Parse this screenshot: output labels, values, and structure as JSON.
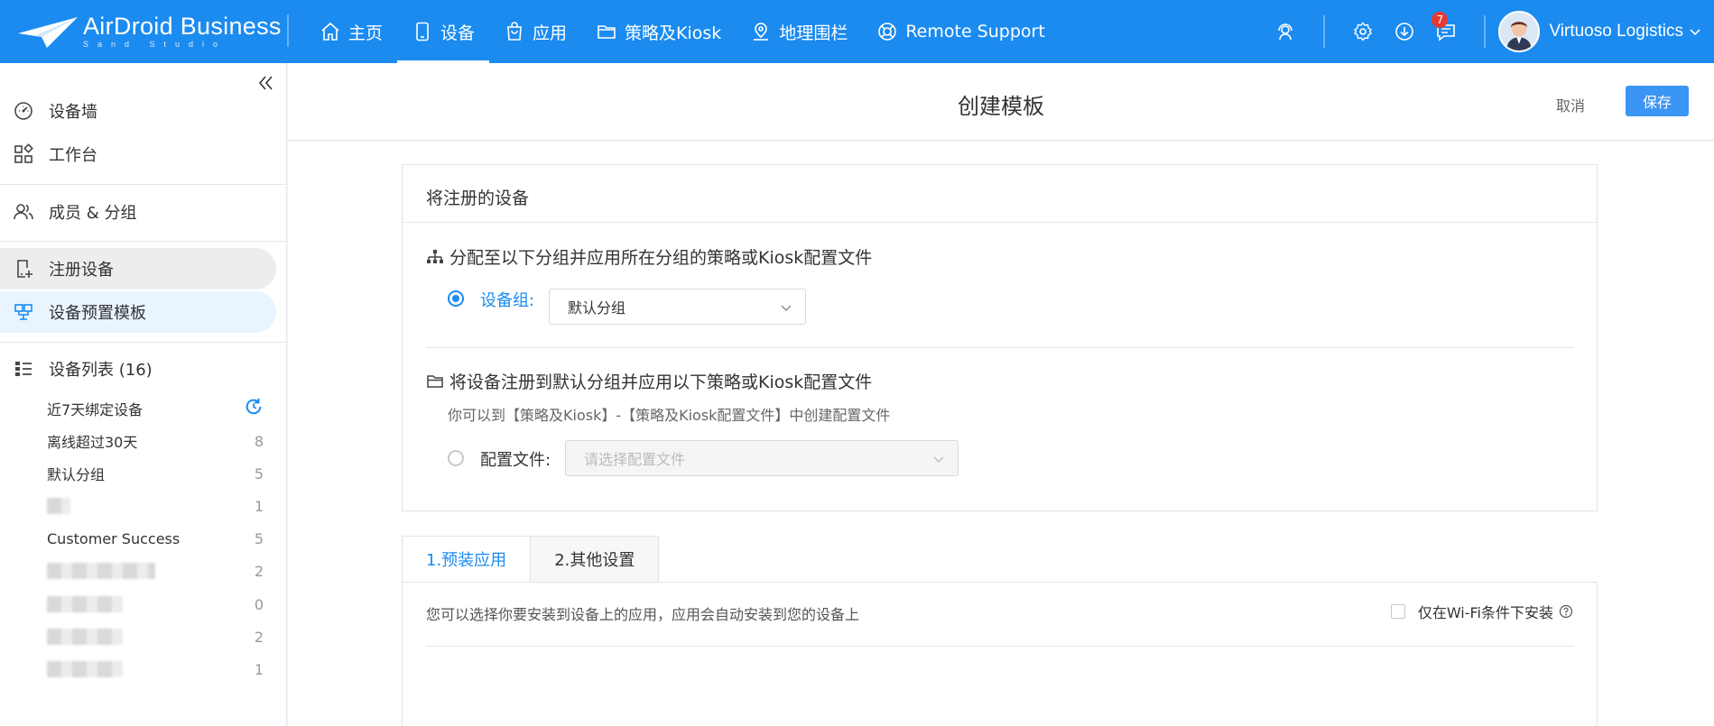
{
  "brand": {
    "name": "AirDroid Business",
    "sub": "Sand Studio"
  },
  "nav": [
    {
      "label": "主页",
      "icon": "home-icon"
    },
    {
      "label": "设备",
      "icon": "device-icon",
      "active": true
    },
    {
      "label": "应用",
      "icon": "app-bag-icon"
    },
    {
      "label": "策略及Kiosk",
      "icon": "folder-icon"
    },
    {
      "label": "地理围栏",
      "icon": "geofence-icon"
    },
    {
      "label": "Remote Support",
      "icon": "lifebuoy-icon"
    }
  ],
  "topbar": {
    "notification_count": "7",
    "user_name": "Virtuoso Logistics"
  },
  "sidebar": {
    "items": [
      {
        "label": "设备墙",
        "icon": "dashboard-icon"
      },
      {
        "label": "工作台",
        "icon": "workbench-icon"
      },
      {
        "label": "成员 & 分组",
        "icon": "members-icon"
      },
      {
        "label": "注册设备",
        "icon": "register-device-icon"
      },
      {
        "label": "设备预置模板",
        "icon": "template-icon"
      },
      {
        "label": "设备列表 (16)",
        "icon": "list-icon"
      }
    ],
    "groups": [
      {
        "name": "近7天绑定设备",
        "count": ""
      },
      {
        "name": "离线超过30天",
        "count": "8"
      },
      {
        "name": "默认分组",
        "count": "5"
      },
      {
        "name": "",
        "count": "1"
      },
      {
        "name": "Customer Success",
        "count": "5"
      },
      {
        "name": "",
        "count": "2"
      },
      {
        "name": "",
        "count": "0"
      },
      {
        "name": "",
        "count": "2"
      },
      {
        "name": "",
        "count": "1"
      }
    ]
  },
  "header": {
    "title": "创建模板",
    "cancel_label": "取消",
    "save_label": "保存"
  },
  "register_card": {
    "title": "将注册的设备",
    "option1": {
      "heading": "分配至以下分组并应用所在分组的策略或Kiosk配置文件",
      "field_label": "设备组:",
      "selected": "默认分组"
    },
    "option2": {
      "heading": "将设备注册到默认分组并应用以下策略或Kiosk配置文件",
      "hint": "你可以到【策略及Kiosk】-【策略及Kiosk配置文件】中创建配置文件",
      "field_label": "配置文件:",
      "placeholder": "请选择配置文件"
    }
  },
  "tabs": [
    {
      "label": "1.预装应用",
      "active": true
    },
    {
      "label": "2.其他设置"
    }
  ],
  "apps_panel": {
    "description": "您可以选择你要安装到设备上的应用，应用会自动安装到您的设备上",
    "wifi_only_label": "仅在Wi-Fi条件下安装"
  },
  "colors": {
    "brand_blue": "#1b8bf0",
    "save_button": "#3b95f5"
  }
}
